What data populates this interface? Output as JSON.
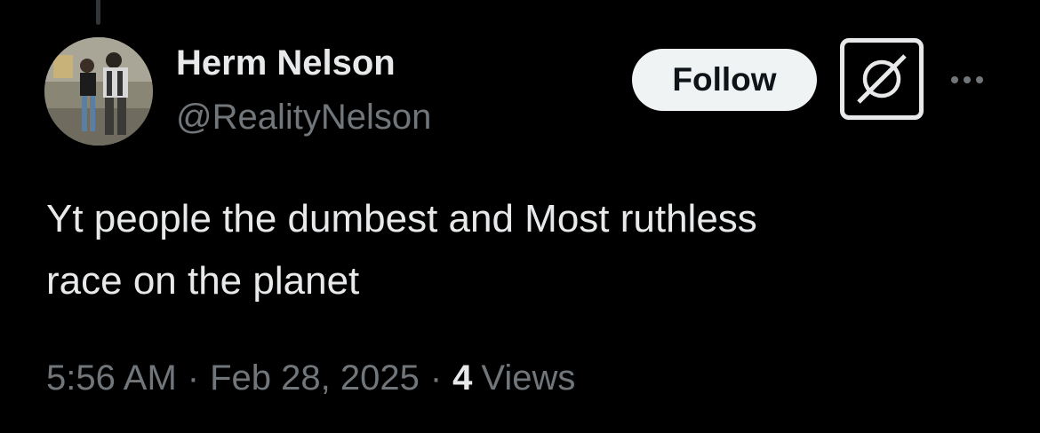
{
  "tweet": {
    "author": {
      "name": "Herm Nelson",
      "handle": "@RealityNelson"
    },
    "follow_label": "Follow",
    "text_lines": [
      "Yt people the dumbest and Most ruthless",
      "race on the planet"
    ],
    "time": "5:56 AM",
    "separator": "·",
    "date": "Feb 28, 2025",
    "views_count": "4",
    "views_label": "Views"
  },
  "icons": {
    "grok": "grok-icon",
    "more": "more-options-icon",
    "avatar": "profile-photo"
  },
  "colors": {
    "background": "#000000",
    "primary_text": "#e7e9ea",
    "secondary_text": "#71767b",
    "follow_bg": "#eff3f4",
    "follow_text": "#0f1419"
  }
}
